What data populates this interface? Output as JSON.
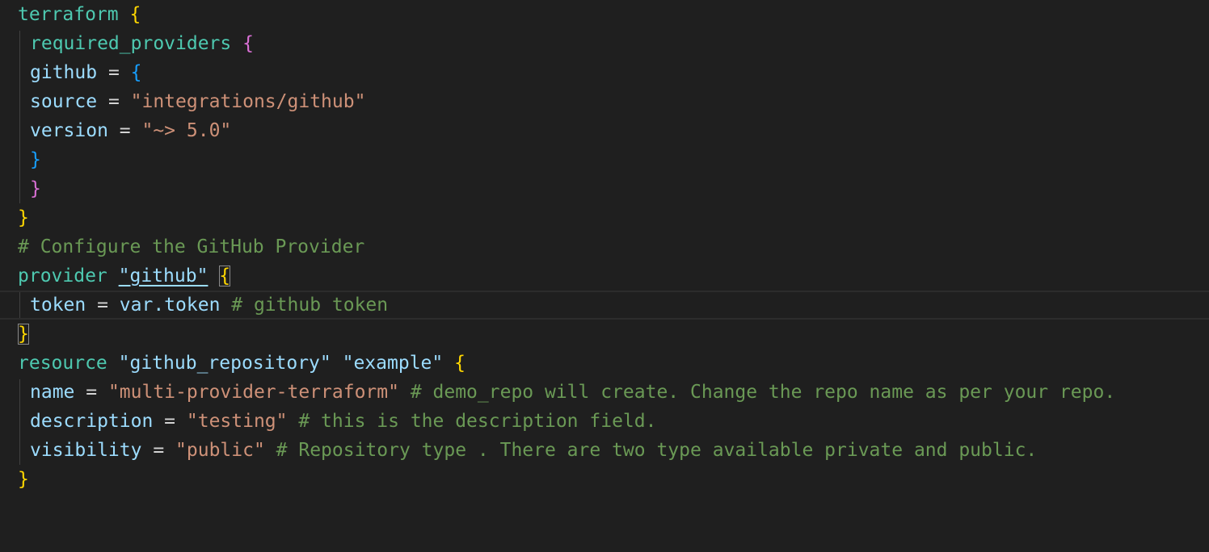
{
  "code": {
    "l1_kw": "terraform",
    "l1_brace": "{",
    "l2_kw": "required_providers",
    "l2_brace": "{",
    "l3_key": "github",
    "l3_eq": " = ",
    "l3_brace": "{",
    "l4_key": "source",
    "l4_eq": " = ",
    "l4_val": "\"integrations/github\"",
    "l5_key": "version",
    "l5_eq": " = ",
    "l5_val": "\"~> 5.0\"",
    "l6_brace": "}",
    "l7_brace": "}",
    "l8_brace": "}",
    "l9_comment": "# Configure the GitHub Provider",
    "l10_kw": "provider",
    "l10_label": "\"github\"",
    "l10_brace": "{",
    "l11_key": "token",
    "l11_eq": " = ",
    "l11_var": "var.token",
    "l11_comment": " # github token",
    "l12_brace": "}",
    "l13_kw": "resource",
    "l13_label1": "\"github_repository\"",
    "l13_label2": "\"example\"",
    "l13_brace": "{",
    "l14_key": "name",
    "l14_eq": " = ",
    "l14_val": "\"multi-provider-terraform\"",
    "l14_comment": " # demo_repo will create. Change the repo name as per your repo.",
    "l15_key": "description",
    "l15_eq": " = ",
    "l15_val": "\"testing\"",
    "l15_comment": " # this is the description field.",
    "l16_key": "visibility",
    "l16_eq": " = ",
    "l16_val": "\"public\"",
    "l16_comment": " # Repository type . There are two type available private and public.",
    "l17_brace": "}"
  },
  "colors": {
    "background": "#1f1f1f",
    "keyword": "#4ec9b0",
    "attribute": "#9cdcfe",
    "string": "#ce9178",
    "comment": "#6a9955",
    "bracket_level1": "#ffd700",
    "bracket_level2": "#da70d6",
    "bracket_level3": "#179fff"
  }
}
